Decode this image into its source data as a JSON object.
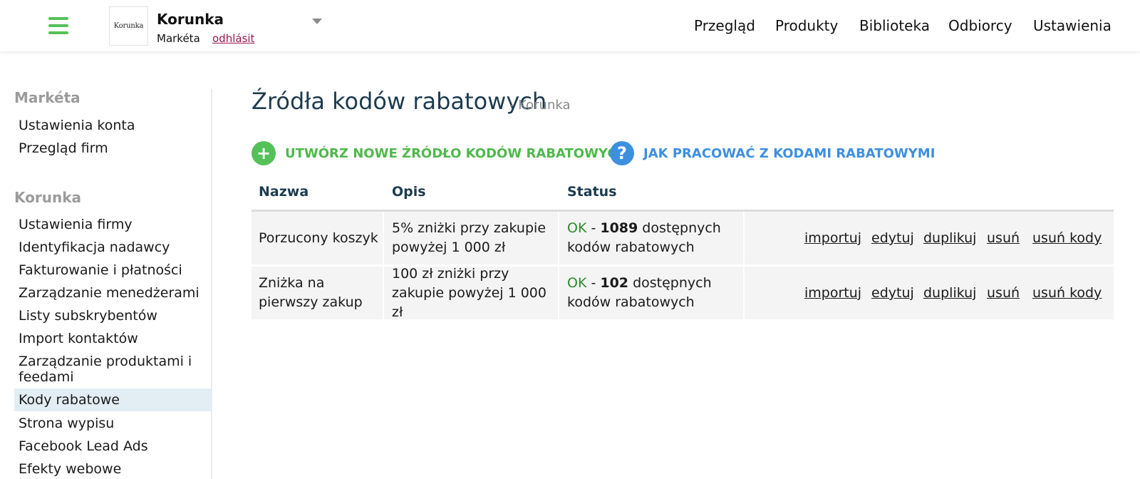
{
  "header": {
    "company_logo_text": "Korunka",
    "company_name": "Korunka",
    "user_name": "Markéta",
    "logout_label": "odhlásit",
    "nav": [
      "Przegląd",
      "Produkty",
      "Biblioteka",
      "Odbiorcy",
      "Ustawienia"
    ]
  },
  "sidebar": {
    "user_heading": "Markéta",
    "user_items": [
      "Ustawienia konta",
      "Przegląd firm"
    ],
    "company_heading": "Korunka",
    "company_items": [
      "Ustawienia firmy",
      "Identyfikacja nadawcy",
      "Fakturowanie i płatności",
      "Zarządzanie menedżerami",
      "Listy subskrybentów",
      "Import kontaktów",
      "Zarządzanie produktami i feedami",
      "Kody rabatowe",
      "Strona wypisu",
      "Facebook Lead Ads",
      "Efekty webowe"
    ],
    "active_item": "Kody rabatowe"
  },
  "main": {
    "title": "Źródła kodów rabatowych",
    "subtitle": "- Korunka",
    "create_label": "UTWÓRZ NOWE ŹRÓDŁO KODÓW RABATOWYCH",
    "create_icon": "+",
    "help_label": "JAK PRACOWAĆ Z KODAMI RABATOWYMI",
    "help_icon": "?"
  },
  "table": {
    "columns": [
      "Nazwa",
      "Opis",
      "Status"
    ],
    "rows": [
      {
        "name": "Porzucony koszyk",
        "description": "5% zniżki przy zakupie powyżej 1 000 zł",
        "status_ok": "OK",
        "status_sep": " - ",
        "status_count": "1089",
        "status_suffix": " dostępnych kodów rabatowych",
        "actions": [
          "importuj",
          "edytuj",
          "duplikuj",
          "usuń",
          "usuń kody"
        ]
      },
      {
        "name": "Zniżka na pierwszy zakup",
        "description": "100 zł zniżki przy zakupie powyżej 1 000 zł",
        "status_ok": "OK",
        "status_sep": " - ",
        "status_count": "102",
        "status_suffix": " dostępnych kodów rabatowych",
        "actions": [
          "importuj",
          "edytuj",
          "duplikuj",
          "usuń",
          "usuń kody"
        ]
      }
    ]
  },
  "colors": {
    "accent_green": "#55c15a",
    "accent_blue": "#3d8fe0",
    "title_navy": "#1d3b4f",
    "logout_link": "#9a1750",
    "status_ok": "#2e8b2e"
  }
}
